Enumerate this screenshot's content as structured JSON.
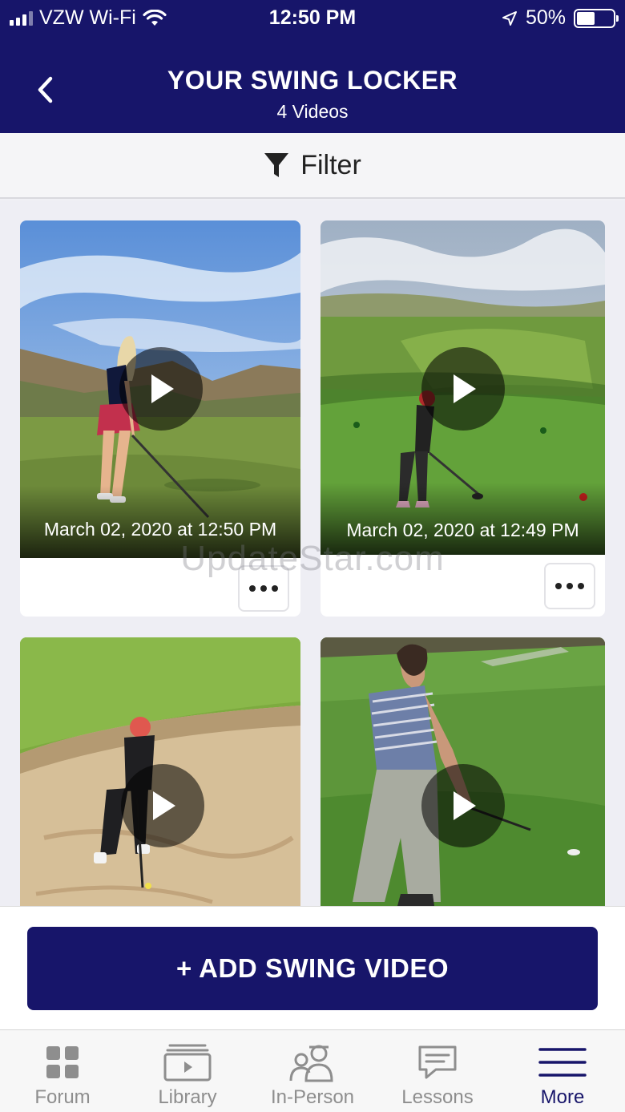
{
  "status_bar": {
    "carrier": "VZW Wi-Fi",
    "time": "12:50 PM",
    "battery": "50%",
    "battery_level": 0.5
  },
  "header": {
    "title": "YOUR SWING LOCKER",
    "subtitle": "4 Videos"
  },
  "filter": {
    "label": "Filter"
  },
  "videos": [
    {
      "date": "March 02, 2020 at 12:50 PM"
    },
    {
      "date": "March 02, 2020 at 12:49 PM"
    },
    {
      "date": ""
    },
    {
      "date": ""
    }
  ],
  "watermark": "UpdateStar.com",
  "add_button": {
    "label": "+ ADD SWING VIDEO"
  },
  "tabs": [
    {
      "label": "Forum",
      "icon": "grid-icon"
    },
    {
      "label": "Library",
      "icon": "video-library-icon"
    },
    {
      "label": "In-Person",
      "icon": "people-icon"
    },
    {
      "label": "Lessons",
      "icon": "chat-icon"
    },
    {
      "label": "More",
      "icon": "menu-icon",
      "active": true
    }
  ],
  "colors": {
    "brand": "#17156a",
    "tab_inactive": "#8e8e8e"
  }
}
